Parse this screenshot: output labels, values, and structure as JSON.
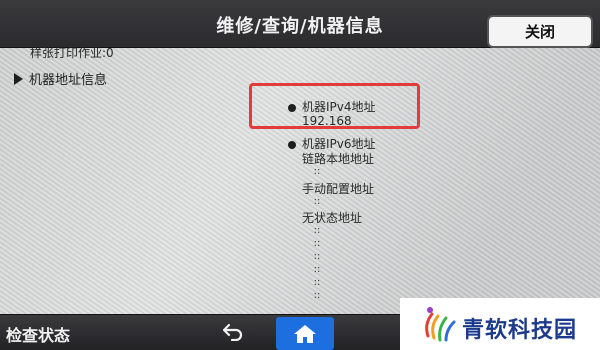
{
  "header": {
    "title": "维修/查询/机器信息",
    "close_label": "关闭"
  },
  "content": {
    "top_row": "样张打印作业:0",
    "section_label": "机器地址信息",
    "ipv4": {
      "label": "机器IPv4地址",
      "value": "192.168"
    },
    "ipv6": {
      "label": "机器IPv6地址",
      "link_local": "链路本地地址",
      "link_local_value": "::",
      "manual": "手动配置地址",
      "manual_value": "::",
      "stateless": "无状态地址",
      "stateless_values": [
        "::",
        "::",
        "::",
        "::",
        "::",
        "::"
      ]
    }
  },
  "footer": {
    "status_label": "检查状态",
    "back_icon": "back-arrow-icon",
    "home_icon": "home-icon",
    "home_color": "#1d6fe0"
  },
  "watermark": {
    "logo_text": "青软科技园"
  },
  "colors": {
    "highlight": "#e23b3b"
  }
}
